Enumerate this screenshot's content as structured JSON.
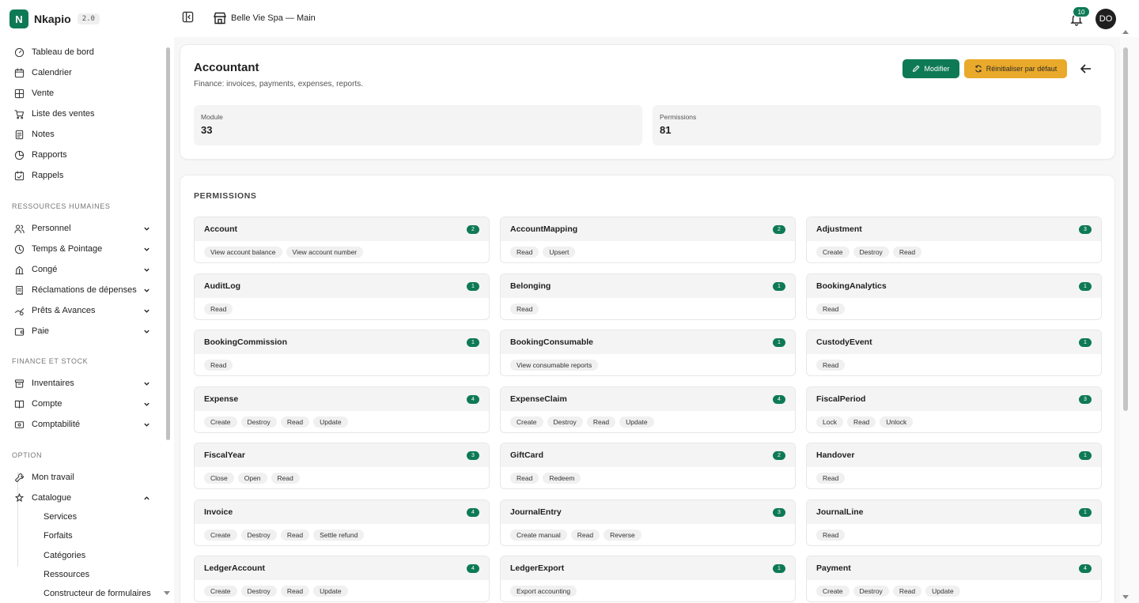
{
  "brand": {
    "name": "Nkapio",
    "version": "2.0"
  },
  "topbar": {
    "store_name": "Belle Vie Spa — Main",
    "notifications_count": "10",
    "avatar_initials": "DO"
  },
  "sidebar": {
    "main_items": [
      {
        "label": "Tableau de bord",
        "icon": "dashboard-icon"
      },
      {
        "label": "Calendrier",
        "icon": "calendar-icon"
      },
      {
        "label": "Vente",
        "icon": "sale-icon"
      },
      {
        "label": "Liste des ventes",
        "icon": "cart-icon"
      },
      {
        "label": "Notes",
        "icon": "notes-icon"
      },
      {
        "label": "Rapports",
        "icon": "chart-icon"
      },
      {
        "label": "Rappels",
        "icon": "reminder-icon"
      }
    ],
    "hr_title": "RESSOURCES HUMAINES",
    "hr_items": [
      {
        "label": "Personnel",
        "icon": "people-icon"
      },
      {
        "label": "Temps & Pointage",
        "icon": "clock-icon"
      },
      {
        "label": "Congé",
        "icon": "leave-icon"
      },
      {
        "label": "Réclamations de dépenses",
        "icon": "receipt-icon"
      },
      {
        "label": "Prêts & Avances",
        "icon": "loan-icon"
      },
      {
        "label": "Paie",
        "icon": "wallet-icon"
      }
    ],
    "finance_title": "FINANCE ET STOCK",
    "finance_items": [
      {
        "label": "Inventaires",
        "icon": "inventory-icon"
      },
      {
        "label": "Compte",
        "icon": "book-icon"
      },
      {
        "label": "Comptabilité",
        "icon": "accounting-icon"
      }
    ],
    "option_title": "OPTION",
    "option_items": [
      {
        "label": "Mon travail",
        "icon": "wrench-icon"
      },
      {
        "label": "Catalogue",
        "icon": "catalog-icon"
      }
    ],
    "catalog_subitems": [
      "Services",
      "Forfaits",
      "Catégories",
      "Ressources",
      "Constructeur de formulaires"
    ]
  },
  "role": {
    "title": "Accountant",
    "description": "Finance: invoices, payments, expenses, reports.",
    "edit_label": "Modifier",
    "reset_label": "Réinitialiser par défaut",
    "stats": [
      {
        "label": "Module",
        "value": "33"
      },
      {
        "label": "Permissions",
        "value": "81"
      }
    ]
  },
  "permissions": {
    "heading": "PERMISSIONS",
    "modules": [
      {
        "name": "Account",
        "count": "2",
        "actions": [
          "View account balance",
          "View account number"
        ]
      },
      {
        "name": "AccountMapping",
        "count": "2",
        "actions": [
          "Read",
          "Upsert"
        ]
      },
      {
        "name": "Adjustment",
        "count": "3",
        "actions": [
          "Create",
          "Destroy",
          "Read"
        ]
      },
      {
        "name": "AuditLog",
        "count": "1",
        "actions": [
          "Read"
        ]
      },
      {
        "name": "Belonging",
        "count": "1",
        "actions": [
          "Read"
        ]
      },
      {
        "name": "BookingAnalytics",
        "count": "1",
        "actions": [
          "Read"
        ]
      },
      {
        "name": "BookingCommission",
        "count": "1",
        "actions": [
          "Read"
        ]
      },
      {
        "name": "BookingConsumable",
        "count": "1",
        "actions": [
          "View consumable reports"
        ]
      },
      {
        "name": "CustodyEvent",
        "count": "1",
        "actions": [
          "Read"
        ]
      },
      {
        "name": "Expense",
        "count": "4",
        "actions": [
          "Create",
          "Destroy",
          "Read",
          "Update"
        ]
      },
      {
        "name": "ExpenseClaim",
        "count": "4",
        "actions": [
          "Create",
          "Destroy",
          "Read",
          "Update"
        ]
      },
      {
        "name": "FiscalPeriod",
        "count": "3",
        "actions": [
          "Lock",
          "Read",
          "Unlock"
        ]
      },
      {
        "name": "FiscalYear",
        "count": "3",
        "actions": [
          "Close",
          "Open",
          "Read"
        ]
      },
      {
        "name": "GiftCard",
        "count": "2",
        "actions": [
          "Read",
          "Redeem"
        ]
      },
      {
        "name": "Handover",
        "count": "1",
        "actions": [
          "Read"
        ]
      },
      {
        "name": "Invoice",
        "count": "4",
        "actions": [
          "Create",
          "Destroy",
          "Read",
          "Settle refund"
        ]
      },
      {
        "name": "JournalEntry",
        "count": "3",
        "actions": [
          "Create manual",
          "Read",
          "Reverse"
        ]
      },
      {
        "name": "JournalLine",
        "count": "1",
        "actions": [
          "Read"
        ]
      },
      {
        "name": "LedgerAccount",
        "count": "4",
        "actions": [
          "Create",
          "Destroy",
          "Read",
          "Update"
        ]
      },
      {
        "name": "LedgerExport",
        "count": "1",
        "actions": [
          "Export accounting"
        ]
      },
      {
        "name": "Payment",
        "count": "4",
        "actions": [
          "Create",
          "Destroy",
          "Read",
          "Update"
        ]
      }
    ]
  },
  "colors": {
    "brand": "#0e7a55",
    "reset_button": "#e9a92a"
  }
}
